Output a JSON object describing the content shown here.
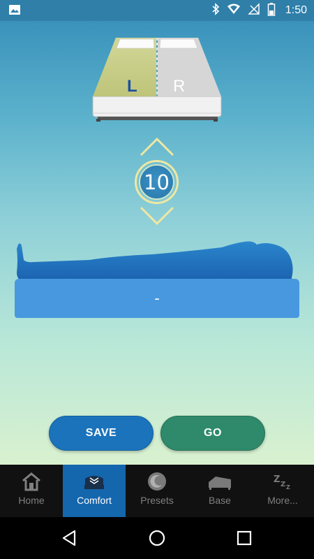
{
  "status_bar": {
    "time": "1:50",
    "icons": [
      "image-icon",
      "bluetooth-icon",
      "wifi-icon",
      "no-signal-icon",
      "battery-icon"
    ]
  },
  "bed": {
    "left_label": "L",
    "right_label": "R",
    "selected_side": "L"
  },
  "comfort": {
    "level": "10",
    "mattress_value": "-"
  },
  "actions": {
    "save_label": "SAVE",
    "go_label": "GO"
  },
  "tabs": [
    {
      "label": "Home",
      "icon": "home-icon",
      "active": false
    },
    {
      "label": "Comfort",
      "icon": "bed-comfort-icon",
      "active": true
    },
    {
      "label": "Presets",
      "icon": "moon-icon",
      "active": false
    },
    {
      "label": "Base",
      "icon": "adjustable-bed-icon",
      "active": false
    },
    {
      "label": "More...",
      "icon": "zzz-icon",
      "active": false
    }
  ],
  "nav": {
    "icons": [
      "back-icon",
      "home-circle-icon",
      "recent-apps-icon"
    ]
  },
  "colors": {
    "status_bar": "#2f7fa9",
    "save_button": "#1b73bc",
    "go_button": "#2e8a6a",
    "active_tab": "#1466ad",
    "mattress": "#4798de",
    "body_silhouette": "#1d6dbb"
  }
}
